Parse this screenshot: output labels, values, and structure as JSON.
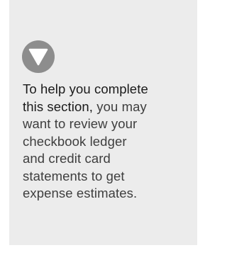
{
  "tip": {
    "icon": "down-arrow-circle-icon",
    "icon_color": "#8d8d8d",
    "lines": [
      {
        "lead": "To help you complete",
        "rest": ""
      },
      {
        "lead": "this section,",
        "rest": " you may"
      },
      {
        "lead": "",
        "rest": "want to review your"
      },
      {
        "lead": "",
        "rest": "checkbook ledger"
      },
      {
        "lead": "",
        "rest": "and credit card"
      },
      {
        "lead": "",
        "rest": "statements to get"
      },
      {
        "lead": "",
        "rest": "expense estimates."
      }
    ]
  }
}
